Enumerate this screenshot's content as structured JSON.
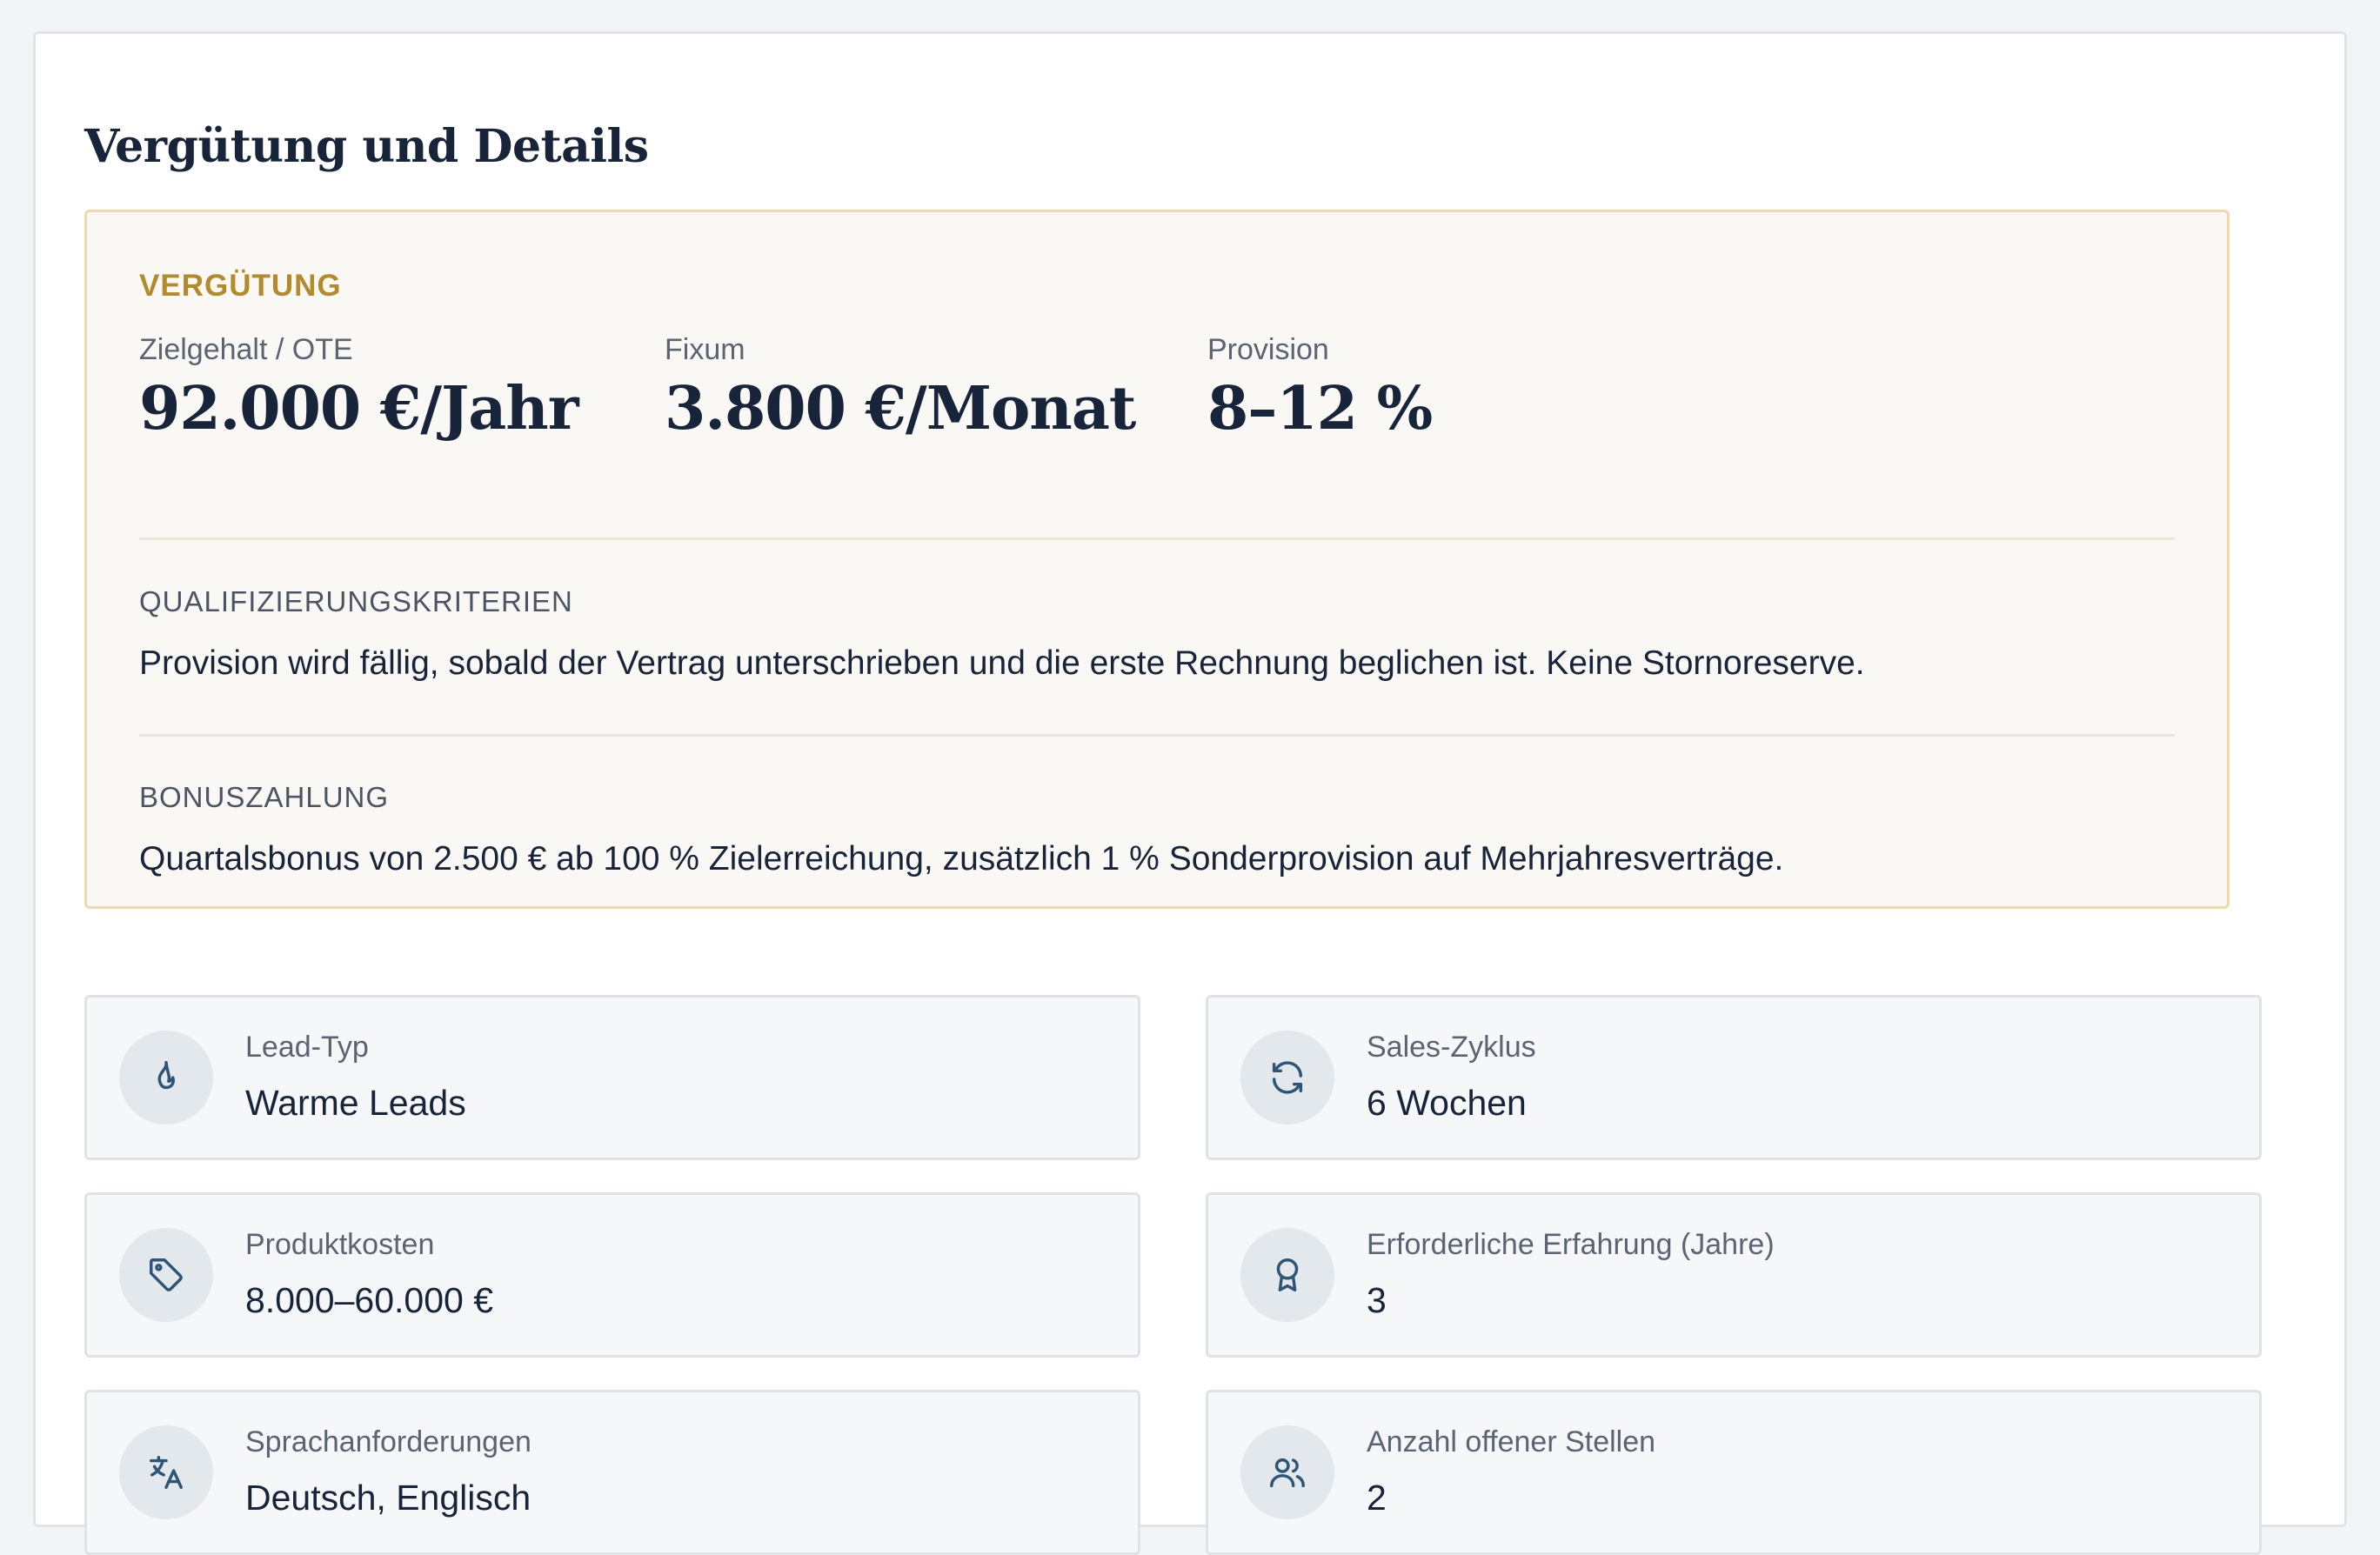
{
  "section": {
    "title": "Vergütung und Details"
  },
  "compensation": {
    "heading": "VERGÜTUNG",
    "stats": [
      {
        "label": "Zielgehalt / OTE",
        "value": "92.000 €/Jahr"
      },
      {
        "label": "Fixum",
        "value": "3.800 €/Monat"
      },
      {
        "label": "Provision",
        "value": "8–12 %"
      }
    ],
    "qualification": {
      "heading": "QUALIFIZIERUNGSKRITERIEN",
      "text": "Provision wird fällig, sobald der Vertrag unterschrieben und die erste Rechnung beglichen ist. Keine Stornoreserve."
    },
    "bonus": {
      "heading": "BONUSZAHLUNG",
      "text": "Quartalsbonus von 2.500 € ab 100 % Zielerreichung, zusätzlich 1 % Sonderprovision auf Mehrjahresverträge."
    }
  },
  "details": [
    {
      "icon": "flame-icon",
      "label": "Lead-Typ",
      "value": "Warme Leads"
    },
    {
      "icon": "refresh-icon",
      "label": "Sales-Zyklus",
      "value": "6 Wochen"
    },
    {
      "icon": "tag-icon",
      "label": "Produktkosten",
      "value": "8.000–60.000 €"
    },
    {
      "icon": "award-icon",
      "label": "Erforderliche Erfahrung (Jahre)",
      "value": "3"
    },
    {
      "icon": "language-icon",
      "label": "Sprachanforderungen",
      "value": "Deutsch, Englisch"
    },
    {
      "icon": "users-icon",
      "label": "Anzahl offener Stellen",
      "value": "2"
    }
  ],
  "colors": {
    "accent_gold": "#b38b2b",
    "text_dark": "#17243a",
    "icon_blue": "#2f5576"
  }
}
